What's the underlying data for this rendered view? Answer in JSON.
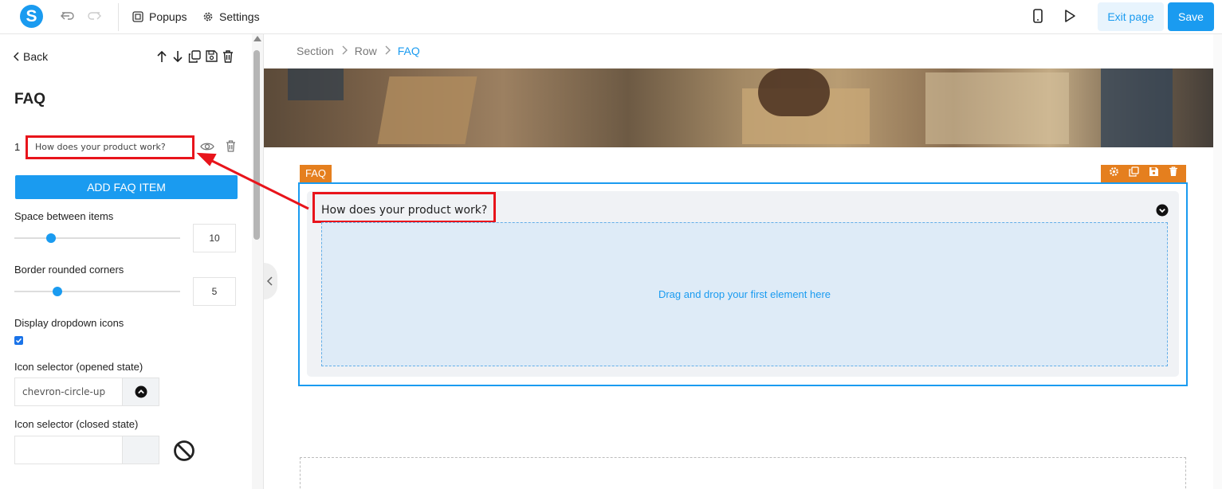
{
  "topbar": {
    "logo_letter": "S",
    "popups_label": "Popups",
    "settings_label": "Settings",
    "exit_label": "Exit page",
    "save_label": "Save"
  },
  "sidebar": {
    "back_label": "Back",
    "title": "FAQ",
    "faq_items": [
      {
        "number": "1",
        "question": "How does your product work?"
      }
    ],
    "add_item_label": "ADD FAQ ITEM",
    "space_label": "Space between items",
    "space_value": "10",
    "space_fraction": 0.22,
    "corners_label": "Border rounded corners",
    "corners_value": "5",
    "corners_fraction": 0.26,
    "dropdown_icons_label": "Display dropdown icons",
    "dropdown_icons_checked": true,
    "icon_opened_label": "Icon selector (opened state)",
    "icon_opened_value": "chevron-circle-up",
    "icon_closed_label": "Icon selector (closed state)",
    "icon_closed_value": ""
  },
  "breadcrumb": [
    "Section",
    "Row",
    "FAQ"
  ],
  "canvas": {
    "faq_tag": "FAQ",
    "faq_question": "How does your product work?",
    "dropzone_text": "Drag and drop your first element here"
  },
  "colors": {
    "accent": "#1a9bf0",
    "element_tag": "#e57f1e",
    "annotation_red": "#e8141b"
  },
  "icons": [
    "undo-icon",
    "redo-icon",
    "popups-icon",
    "gear-icon",
    "mobile-icon",
    "play-icon",
    "arrow-up-icon",
    "arrow-down-icon",
    "copy-icon",
    "save-icon",
    "trash-icon",
    "eye-icon",
    "chevron-circle-up-icon",
    "ban-icon",
    "chevron-left-icon",
    "chevron-circle-down-icon"
  ]
}
